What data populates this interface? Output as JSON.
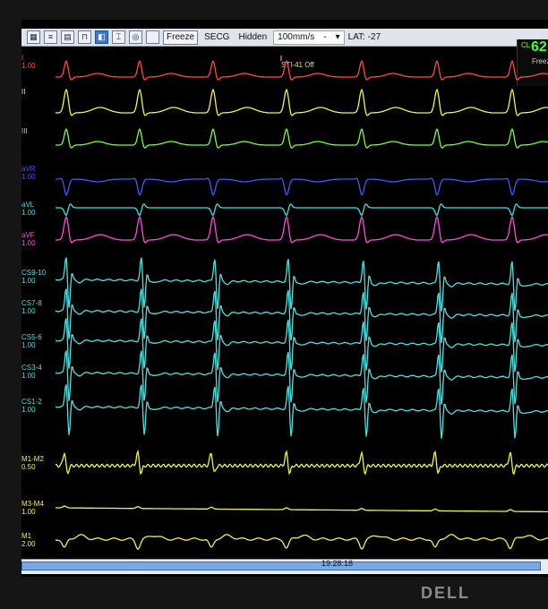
{
  "toolbar": {
    "freeze_label": "Freeze",
    "secg_label": "SECG",
    "hidden_label": "Hidden",
    "sweep_speed": "100mm/s",
    "sweep_dash": "-",
    "lat_label": "LAT: -27"
  },
  "marker": {
    "label": "STI-41 Off"
  },
  "cycle_length": {
    "label": "CL",
    "value": "62",
    "sub": "Freez"
  },
  "leads": [
    {
      "name": "I",
      "gain": "1.00",
      "color": "#ff4a4a"
    },
    {
      "name": "II",
      "gain": "",
      "color": "#f3f34a"
    },
    {
      "name": "III",
      "gain": "",
      "color": "#7cff3a"
    },
    {
      "name": "aVR",
      "gain": "1.00",
      "color": "#3b5bff"
    },
    {
      "name": "aVL",
      "gain": "1.00",
      "color": "#43e0e0"
    },
    {
      "name": "aVF",
      "gain": "1.00",
      "color": "#ff4adf"
    },
    {
      "name": "CS9-10",
      "gain": "1.00",
      "color": "#4fe0e0"
    },
    {
      "name": "CS7-8",
      "gain": "1.00",
      "color": "#4fe0e0"
    },
    {
      "name": "CS5-6",
      "gain": "1.00",
      "color": "#4fe0e0"
    },
    {
      "name": "CS3-4",
      "gain": "1.00",
      "color": "#4fe0e0"
    },
    {
      "name": "CS1-2",
      "gain": "1.00",
      "color": "#4fe0e0"
    },
    {
      "name": "M1-M2",
      "gain": "0.50",
      "color": "#f3f34a"
    },
    {
      "name": "M3-M4",
      "gain": "1.00",
      "color": "#f3f34a"
    },
    {
      "name": "M1",
      "gain": "2.00",
      "color": "#f3f34a"
    }
  ],
  "footer": {
    "timestamp": "19:28:18"
  },
  "brand": {
    "name": "DELL"
  }
}
